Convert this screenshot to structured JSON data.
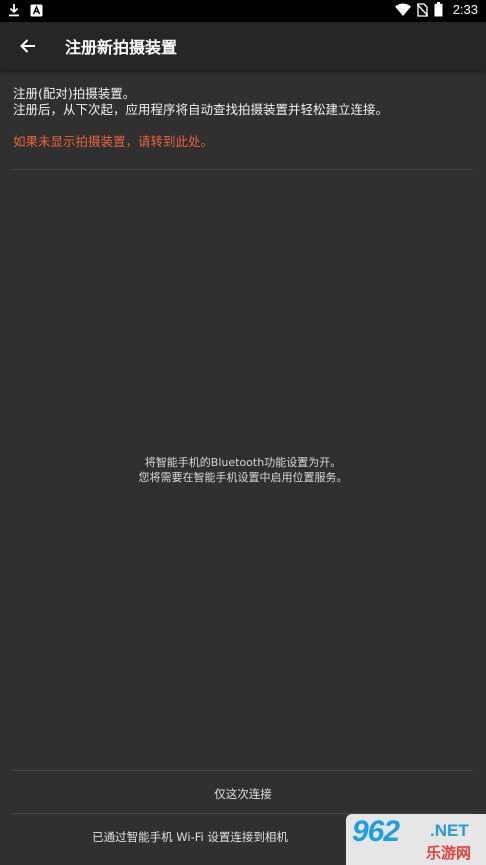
{
  "status_bar": {
    "time": "2:33",
    "icons": [
      "download-icon",
      "app-notification-icon",
      "wifi-icon",
      "no-sim-icon",
      "battery-icon"
    ]
  },
  "app_bar": {
    "title": "注册新拍摄装置",
    "back_icon": "arrow-left-icon"
  },
  "intro": {
    "line1": "注册(配对)拍摄装置。",
    "line2": "注册后，从下次起，应用程序将自动查找拍摄装置并轻松建立连接。"
  },
  "warning_link": "如果未显示拍摄装置，请转到此处。",
  "center_message": {
    "line1": "将智能手机的Bluetooth功能设置为开。",
    "line2": "您将需要在智能手机设置中启用位置服务。"
  },
  "actions": {
    "connect_once": "仅这次连接",
    "wifi_connect": "已通过智能手机 Wi-Fi 设置连接到相机"
  },
  "watermark": {
    "main": "962",
    "suffix": ".NET",
    "sub": "乐游网"
  },
  "colors": {
    "background": "#303030",
    "app_bar": "#262626",
    "warning": "#e8643c"
  }
}
